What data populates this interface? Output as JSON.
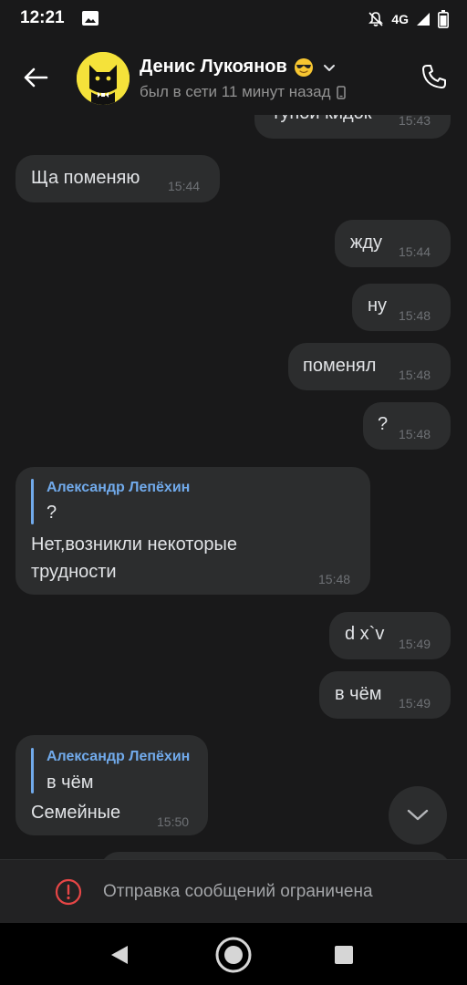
{
  "status_bar": {
    "time": "12:21",
    "network": "4G",
    "icons": [
      "image-icon",
      "mute-icon",
      "signal-icon",
      "battery-icon"
    ]
  },
  "header": {
    "contact_name": "Денис Лукоянов",
    "last_seen": "был в сети 11 минут назад",
    "icons": [
      "back-arrow-icon",
      "sunglasses-emoji-icon",
      "chevron-down-icon",
      "mobile-device-icon",
      "phone-icon"
    ]
  },
  "messages": [
    {
      "id": "m0",
      "direction": "out",
      "text": "тупой кидок",
      "time": "15:43"
    },
    {
      "id": "m1",
      "direction": "in",
      "text": "Ща поменяю",
      "time": "15:44"
    },
    {
      "id": "m2",
      "direction": "out",
      "text": "жду",
      "time": "15:44"
    },
    {
      "id": "m3",
      "direction": "out",
      "text": "ну",
      "time": "15:48"
    },
    {
      "id": "m4",
      "direction": "out",
      "text": "поменял",
      "time": "15:48"
    },
    {
      "id": "m5",
      "direction": "out",
      "text": "?",
      "time": "15:48"
    },
    {
      "id": "m6",
      "direction": "in",
      "reply_author": "Александр Лепёхин",
      "reply_text": "?",
      "text_lines": [
        "Нет,возникли некоторые",
        "трудности"
      ],
      "time": "15:48"
    },
    {
      "id": "m7",
      "direction": "out",
      "text": "d x`v",
      "time": "15:49"
    },
    {
      "id": "m8",
      "direction": "out",
      "text": "в чём",
      "time": "15:49"
    },
    {
      "id": "m9",
      "direction": "in",
      "reply_author": "Александр Лепёхин",
      "reply_text": "в чём",
      "text": "Семейные",
      "time": "15:50"
    }
  ],
  "composer": {
    "restricted_text": "Отправка сообщений ограничена"
  },
  "colors": {
    "background": "#19191a",
    "bubble": "#2c2d2e",
    "accent": "#71aaeb",
    "error": "#e64646"
  }
}
